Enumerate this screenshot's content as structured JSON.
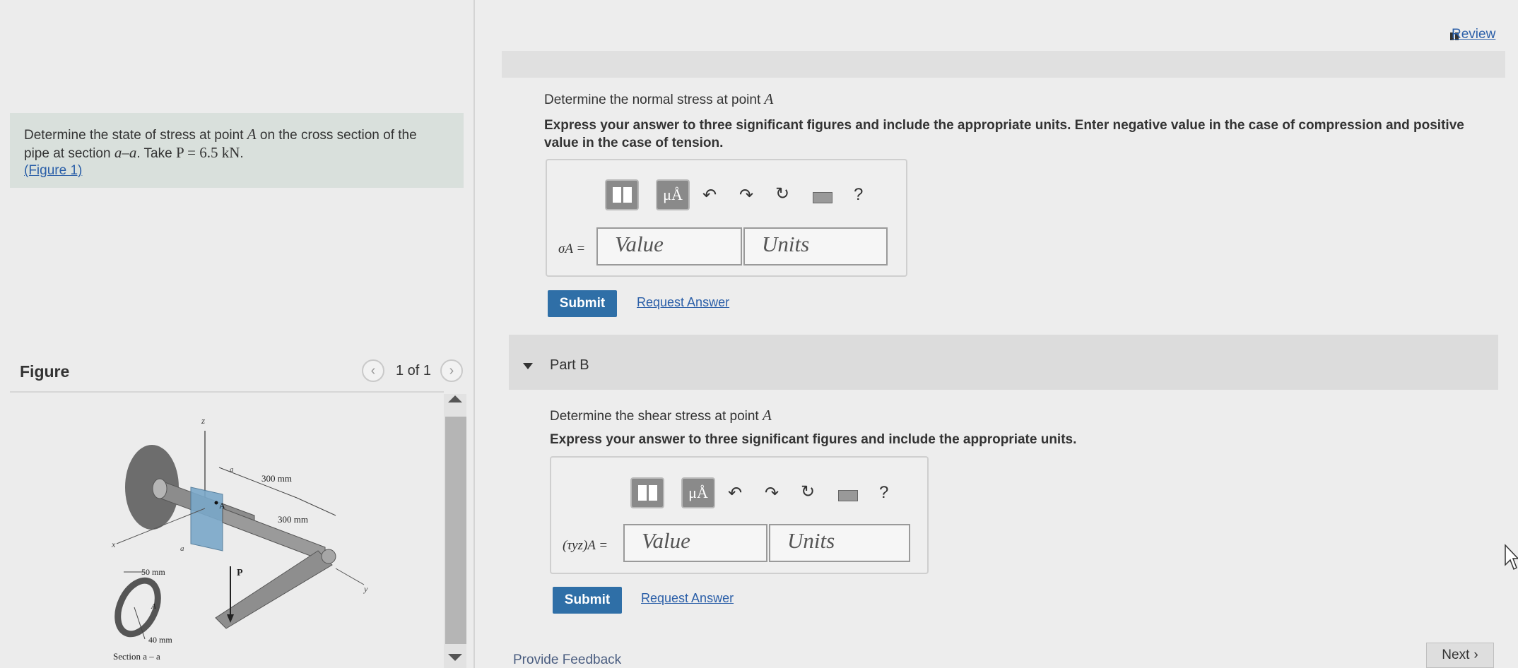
{
  "review": {
    "label": "Review"
  },
  "problem": {
    "text_before_A": "Determine the state of stress at point",
    "point": "A",
    "text_after_A": "on the cross section of the",
    "line2_before": "pipe at section",
    "section": "a–a",
    "line2_take": ". Take",
    "p_expr": "P = 6.5 kN",
    "p_dot": ".",
    "figure_link": "(Figure 1)"
  },
  "figure_panel": {
    "label": "Figure",
    "pager": "1 of 1",
    "prev_icon": "chevron-left-icon",
    "next_icon": "chevron-right-icon",
    "labels": {
      "z": "z",
      "x": "x",
      "y": "y",
      "a_top": "a",
      "a_bottom": "a",
      "point_a": "A",
      "len1": "300 mm",
      "len2": "300 mm",
      "load": "P",
      "outer_r": "50 mm",
      "inner_r": "40 mm",
      "point_a_section": "A",
      "section_caption": "Section a – a"
    }
  },
  "part_a": {
    "question_prefix": "Determine the normal stress at point",
    "point": "A",
    "instructions": "Express your answer to three significant figures and include the appropriate units. Enter negative value in the case of compression and positive value in the case of tension.",
    "equation_label": "σA =",
    "value_placeholder": "Value",
    "units_placeholder": "Units",
    "submit": "Submit",
    "request_answer": "Request Answer",
    "toolbar": {
      "templates_icon": "templates-icon",
      "units_label": "μÅ",
      "undo_icon": "undo-icon",
      "redo_icon": "redo-icon",
      "reset_icon": "reset-icon",
      "keyboard_icon": "keyboard-icon",
      "help_label": "?"
    }
  },
  "part_b": {
    "title": "Part B",
    "question_prefix": "Determine the shear stress at point",
    "point": "A",
    "instructions": "Express your answer to three significant figures and include the appropriate units.",
    "equation_label": "(τyz)A =",
    "value_placeholder": "Value",
    "units_placeholder": "Units",
    "submit": "Submit",
    "request_answer": "Request Answer",
    "toolbar": {
      "units_label": "μÅ",
      "help_label": "?"
    }
  },
  "footer": {
    "feedback": "Provide Feedback",
    "next": "Next"
  },
  "colors": {
    "accent": "#2f6fa7",
    "link": "#2b5fa8",
    "problem_bg": "#d9e0dc"
  }
}
